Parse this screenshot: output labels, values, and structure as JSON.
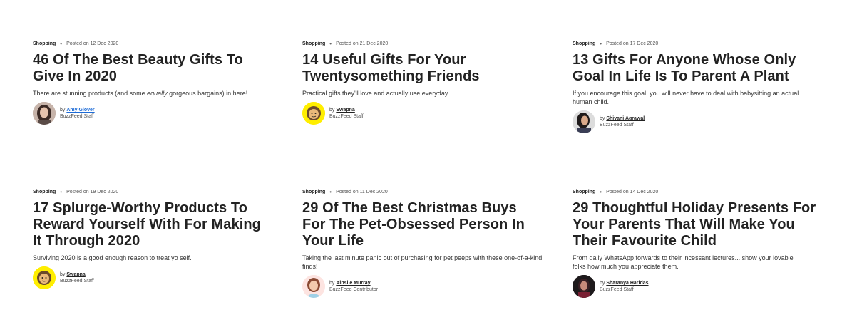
{
  "articles": [
    {
      "category": "Shopping",
      "posted": "Posted on 12 Dec 2020",
      "title": "46 Of The Best Beauty Gifts To Give In 2020",
      "desc_pre": "There are stunning products (and some ",
      "desc_em": "equally",
      "desc_post": " gorgeous bargains) in here!",
      "by": "by",
      "author": "Amy Glover",
      "role": "BuzzFeed Staff",
      "avatar_icon": "woman-photo-avatar"
    },
    {
      "category": "Shopping",
      "posted": "Posted on 21 Dec 2020",
      "title": "14 Useful Gifts For Your Twentysomething Friends",
      "desc": "Practical gifts they'll love and actually use everyday.",
      "by": "by",
      "author": "Swapna",
      "role": "BuzzFeed Staff",
      "avatar_icon": "cartoon-face-avatar"
    },
    {
      "category": "Shopping",
      "posted": "Posted on 17 Dec 2020",
      "title": "13 Gifts For Anyone Whose Only Goal In Life Is To Parent A Plant",
      "desc": "If you encourage this goal, you will never have to deal with babysitting an actual human child.",
      "by": "by",
      "author": "Shivani Agrawal",
      "role": "BuzzFeed Staff",
      "avatar_icon": "woman-photo-avatar"
    },
    {
      "category": "Shopping",
      "posted": "Posted on 19 Dec 2020",
      "title": "17 Splurge-Worthy Products To Reward Yourself With For Making It Through 2020",
      "desc": "Surviving 2020 is a good enough reason to treat yo self.",
      "by": "by",
      "author": "Swapna",
      "role": "BuzzFeed Staff",
      "avatar_icon": "cartoon-face-avatar"
    },
    {
      "category": "Shopping",
      "posted": "Posted on 11 Dec 2020",
      "title": "29 Of The Best Christmas Buys For The Pet-Obsessed Person In Your Life",
      "desc": "Taking the last minute panic out of purchasing for pet peeps with these one-of-a-kind finds!",
      "by": "by",
      "author": "Ainslie Murray",
      "role": "BuzzFeed Contributor",
      "avatar_icon": "illustrated-woman-avatar"
    },
    {
      "category": "Shopping",
      "posted": "Posted on 14 Dec 2020",
      "title": "29 Thoughtful Holiday Presents For Your Parents That Will Make You Their Favourite Child",
      "desc": "From daily WhatsApp forwards to their incessant lectures... show your lovable folks how much you appreciate them.",
      "by": "by",
      "author": "Sharanya Haridas",
      "role": "BuzzFeed Staff",
      "avatar_icon": "woman-photo-avatar"
    }
  ],
  "colors": {
    "text": "#222222",
    "link_blue": "#1d6bd6",
    "avatar_yellow": "#ffee00"
  }
}
